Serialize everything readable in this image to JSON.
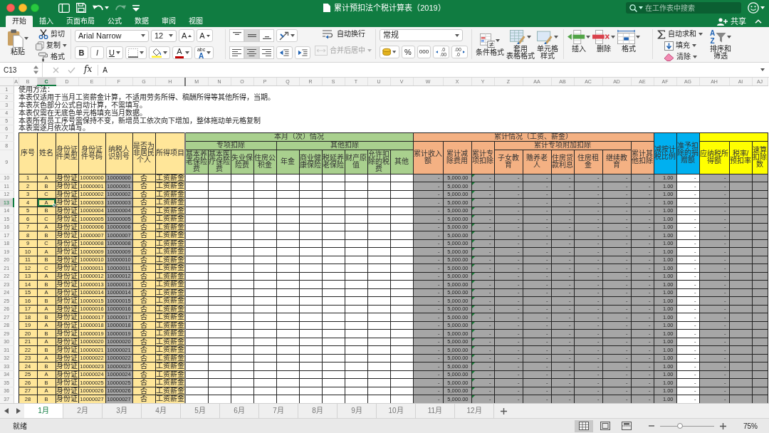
{
  "window": {
    "title": "累计预扣法个税计算表（2019）",
    "search": {
      "placeholder": "在工作表中搜索"
    }
  },
  "quick_access": [
    {
      "disabled": false
    },
    {
      "disabled": false
    },
    {
      "disabled": false
    },
    {
      "disabled": true
    },
    {
      "disabled": false
    }
  ],
  "ribbon_tabs": [
    {
      "label": "开始",
      "selected": true
    },
    {
      "label": "插入",
      "selected": false
    },
    {
      "label": "页面布局",
      "selected": false
    },
    {
      "label": "公式",
      "selected": false
    },
    {
      "label": "数据",
      "selected": false
    },
    {
      "label": "审阅",
      "selected": false
    },
    {
      "label": "视图",
      "selected": false
    }
  ],
  "share": {
    "label": "共享"
  },
  "ribbon": {
    "paste": {
      "label": "粘贴"
    },
    "clipboard": [
      {
        "label": "剪切"
      },
      {
        "label": "复制"
      },
      {
        "label": "格式"
      }
    ],
    "font_name": "Arial Narrow",
    "font_size": "12",
    "grow_font": "A",
    "shrink_font": "A",
    "text_styles": [
      {
        "label": "B"
      },
      {
        "label": "I"
      },
      {
        "label": "U"
      }
    ],
    "font_color": "A",
    "phonetic": [
      "abc",
      "A"
    ],
    "vertical_align": [
      {
        "selected": false
      },
      {
        "selected": true
      },
      {
        "selected": false
      }
    ],
    "horizontal_align": [
      {
        "selected": false
      },
      {
        "selected": true
      },
      {
        "selected": false
      }
    ],
    "wrap_text": {
      "label": "自动换行"
    },
    "merge_center": {
      "label": "合并后居中",
      "disabled": true
    },
    "number_format": "常规",
    "percent": "%",
    "thousands": "000",
    "increase_decimal": [
      ".0",
      ".00"
    ],
    "decrease_decimal": [
      ".00",
      ".0"
    ],
    "styles": [
      {
        "lines": [
          "条件格式"
        ]
      },
      {
        "lines": [
          "套用",
          "表格格式"
        ]
      },
      {
        "lines": [
          "单元格",
          "样式"
        ]
      }
    ],
    "cells": [
      {
        "lines": [
          "插入"
        ]
      },
      {
        "lines": [
          "删除"
        ]
      },
      {
        "lines": [
          "格式"
        ]
      }
    ],
    "editing": [
      {
        "label": "自动求和"
      },
      {
        "label": "填充"
      },
      {
        "label": "清除"
      }
    ],
    "sort_filter": {
      "glyphs": [
        "A",
        "Z"
      ],
      "lines": [
        "排序和",
        "筛选"
      ]
    }
  },
  "formula_bar": {
    "name_box": "C13",
    "fx": "fx",
    "value": "A"
  },
  "sheet": {
    "columns": [
      {
        "letter": "A",
        "kind": "margin",
        "selected": false,
        "flagged": false,
        "split": false
      },
      {
        "letter": "B",
        "kind": "info",
        "selected": false,
        "flagged": false,
        "split": false
      },
      {
        "letter": "C",
        "kind": "info",
        "selected": true,
        "flagged": false,
        "split": false
      },
      {
        "letter": "D",
        "kind": "info",
        "selected": false,
        "flagged": false,
        "split": false
      },
      {
        "letter": "E",
        "kind": "info",
        "selected": false,
        "flagged": false,
        "split": false
      },
      {
        "letter": "F",
        "kind": "formula",
        "selected": false,
        "flagged": false,
        "split": false
      },
      {
        "letter": "G",
        "kind": "info",
        "selected": false,
        "flagged": false,
        "split": false
      },
      {
        "letter": "H",
        "kind": "info",
        "selected": false,
        "flagged": false,
        "split": false
      },
      {
        "letter": "M",
        "kind": "entry",
        "selected": false,
        "flagged": false,
        "split": true
      },
      {
        "letter": "N",
        "kind": "entry",
        "selected": false,
        "flagged": false,
        "split": false
      },
      {
        "letter": "O",
        "kind": "entry",
        "selected": false,
        "flagged": false,
        "split": false
      },
      {
        "letter": "P",
        "kind": "entry",
        "selected": false,
        "flagged": false,
        "split": false
      },
      {
        "letter": "Q",
        "kind": "entry",
        "selected": false,
        "flagged": false,
        "split": false
      },
      {
        "letter": "R",
        "kind": "entry",
        "selected": false,
        "flagged": false,
        "split": false
      },
      {
        "letter": "S",
        "kind": "entry",
        "selected": false,
        "flagged": false,
        "split": false
      },
      {
        "letter": "T",
        "kind": "entry",
        "selected": false,
        "flagged": false,
        "split": false
      },
      {
        "letter": "U",
        "kind": "entry",
        "selected": false,
        "flagged": false,
        "split": false
      },
      {
        "letter": "V",
        "kind": "entry",
        "selected": false,
        "flagged": false,
        "split": false
      },
      {
        "letter": "W",
        "kind": "formula",
        "selected": false,
        "flagged": false,
        "split": false
      },
      {
        "letter": "X",
        "kind": "formula",
        "selected": false,
        "flagged": false,
        "split": false
      },
      {
        "letter": "Y",
        "kind": "formula",
        "selected": false,
        "flagged": true,
        "split": false
      },
      {
        "letter": "Z",
        "kind": "formula",
        "selected": false,
        "flagged": false,
        "split": false
      },
      {
        "letter": "AA",
        "kind": "formula",
        "selected": false,
        "flagged": false,
        "split": false
      },
      {
        "letter": "AB",
        "kind": "formula",
        "selected": false,
        "flagged": false,
        "split": false
      },
      {
        "letter": "AC",
        "kind": "formula",
        "selected": false,
        "flagged": false,
        "split": false
      },
      {
        "letter": "AD",
        "kind": "formula",
        "selected": false,
        "flagged": false,
        "split": false
      },
      {
        "letter": "AE",
        "kind": "formula",
        "selected": false,
        "flagged": false,
        "split": false
      },
      {
        "letter": "AF",
        "kind": "formula",
        "selected": false,
        "flagged": false,
        "split": false
      },
      {
        "letter": "AG",
        "kind": "entry",
        "selected": false,
        "flagged": false,
        "split": false
      },
      {
        "letter": "AH",
        "kind": "formula",
        "selected": false,
        "flagged": false,
        "split": false
      },
      {
        "letter": "AI",
        "kind": "formula",
        "selected": false,
        "flagged": false,
        "split": false
      },
      {
        "letter": "AJ",
        "kind": "formula",
        "selected": false,
        "flagged": false,
        "split": false
      }
    ],
    "notes": [
      {
        "number": "1",
        "selected": false,
        "text": "使用方法："
      },
      {
        "number": "2",
        "selected": false,
        "text": "本表仅适用于当月工资薪金计算，不适用劳务所得、稿酬所得等其他所得，当期。"
      },
      {
        "number": "3",
        "selected": false,
        "text": "本表灰色部分公式自动计算，不需填写。"
      },
      {
        "number": "4",
        "selected": false,
        "text": "本表仅需在无底色单元格填充当月数据。"
      },
      {
        "number": "5",
        "selected": false,
        "text": "本表所有员工序号需保持不变，新增员工依次向下增加，整体拖动单元格复制"
      },
      {
        "number": "6",
        "selected": false,
        "text": "本表需逐月依次填写。"
      }
    ],
    "header_rows": [
      {
        "number": "7",
        "selected": false
      },
      {
        "number": "8",
        "selected": false
      },
      {
        "number": "9",
        "selected": false
      }
    ],
    "header": [
      {
        "label": "序号",
        "color": "#ffe699"
      },
      {
        "label": "姓名",
        "color": "#ffe699"
      },
      {
        "label": "身份证件类型",
        "color": "#ffe699"
      },
      {
        "label": "身份证件号码",
        "color": "#ffe699"
      },
      {
        "label": "纳税人识别号",
        "color": "#ffe699"
      },
      {
        "label": "是否为非居民个人",
        "color": "#ffe699"
      },
      {
        "label": "所得项目",
        "color": "#ffe699"
      },
      {
        "label": "本月（次）情况",
        "color": "#a9d08e",
        "children": [
          {
            "label": "专项扣除",
            "children": [
              {
                "label": "基本养老保险费"
              },
              {
                "label": "基本医疗保险费"
              },
              {
                "label": "失业保险费"
              },
              {
                "label": "住房公积金"
              }
            ]
          },
          {
            "label": "其他扣除",
            "children": [
              {
                "label": "年金"
              },
              {
                "label": "商业健康保险"
              },
              {
                "label": "税延养老保险"
              },
              {
                "label": "财产原值"
              },
              {
                "label": "允许扣除的税费"
              },
              {
                "label": "其他"
              }
            ]
          }
        ]
      },
      {
        "label": "累计情况（工资、薪金）",
        "color": "#f4b183",
        "children": [
          {
            "label": "累计收入额"
          },
          {
            "label": "累计减除费用"
          },
          {
            "label": "累计专项扣除"
          },
          {
            "label": "累计专项附加扣除",
            "children": [
              {
                "label": "子女教育"
              },
              {
                "label": "赡养老人"
              },
              {
                "label": "住房贷款利息"
              },
              {
                "label": "住房租金"
              },
              {
                "label": "继续教育"
              }
            ]
          },
          {
            "label": "累计其他扣除"
          }
        ]
      },
      {
        "label": "减按计税比例",
        "color": "#00b0f0"
      },
      {
        "label": "准予扣除的捐赠额",
        "color": "#00b0f0"
      },
      {
        "color": "#ffff00",
        "children": [
          {
            "label": "应纳税所得额"
          },
          {
            "label": "税率/预扣率"
          },
          {
            "label": "速算扣除数"
          }
        ]
      }
    ],
    "rows": [
      {
        "number": "10",
        "selected": false,
        "cells": [
          "",
          "1",
          "A",
          "身份证",
          "10000000",
          "10000000",
          "否",
          "工资薪金",
          "",
          "",
          "",
          "",
          "",
          "",
          "",
          "",
          "",
          "",
          "-",
          "5,000.00",
          "-",
          "-",
          "-",
          "-",
          "-",
          "-",
          "-",
          "1.00",
          "-",
          "-",
          "",
          ""
        ]
      },
      {
        "number": "11",
        "selected": false,
        "cells": [
          "",
          "2",
          "B",
          "身份证",
          "10000001",
          "10000001",
          "否",
          "工资薪金",
          "",
          "",
          "",
          "",
          "",
          "",
          "",
          "",
          "",
          "",
          "-",
          "5,000.00",
          "-",
          "-",
          "-",
          "-",
          "-",
          "-",
          "-",
          "1.00",
          "-",
          "-",
          "",
          ""
        ]
      },
      {
        "number": "12",
        "selected": false,
        "cells": [
          "",
          "3",
          "C",
          "身份证",
          "10000002",
          "10000002",
          "否",
          "工资薪金",
          "",
          "",
          "",
          "",
          "",
          "",
          "",
          "",
          "",
          "",
          "-",
          "5,000.00",
          "-",
          "-",
          "-",
          "-",
          "-",
          "-",
          "-",
          "1.00",
          "-",
          "-",
          "",
          ""
        ]
      },
      {
        "number": "13",
        "selected": true,
        "cells": [
          "",
          "4",
          "A",
          "身份证",
          "10000003",
          "10000003",
          "否",
          "工资薪金",
          "",
          "",
          "",
          "",
          "",
          "",
          "",
          "",
          "",
          "",
          "-",
          "5,000.00",
          "-",
          "-",
          "-",
          "-",
          "-",
          "-",
          "-",
          "1.00",
          "-",
          "-",
          "",
          ""
        ]
      },
      {
        "number": "14",
        "selected": false,
        "cells": [
          "",
          "5",
          "B",
          "身份证",
          "10000004",
          "10000004",
          "否",
          "工资薪金",
          "",
          "",
          "",
          "",
          "",
          "",
          "",
          "",
          "",
          "",
          "-",
          "5,000.00",
          "-",
          "-",
          "-",
          "-",
          "-",
          "-",
          "-",
          "1.00",
          "-",
          "-",
          "",
          ""
        ]
      },
      {
        "number": "15",
        "selected": false,
        "cells": [
          "",
          "6",
          "C",
          "身份证",
          "10000005",
          "10000005",
          "否",
          "工资薪金",
          "",
          "",
          "",
          "",
          "",
          "",
          "",
          "",
          "",
          "",
          "-",
          "5,000.00",
          "-",
          "-",
          "-",
          "-",
          "-",
          "-",
          "-",
          "1.00",
          "-",
          "-",
          "",
          ""
        ]
      },
      {
        "number": "16",
        "selected": false,
        "cells": [
          "",
          "7",
          "A",
          "身份证",
          "10000006",
          "10000006",
          "否",
          "工资薪金",
          "",
          "",
          "",
          "",
          "",
          "",
          "",
          "",
          "",
          "",
          "-",
          "5,000.00",
          "-",
          "-",
          "-",
          "-",
          "-",
          "-",
          "-",
          "1.00",
          "-",
          "-",
          "",
          ""
        ]
      },
      {
        "number": "17",
        "selected": false,
        "cells": [
          "",
          "8",
          "B",
          "身份证",
          "10000007",
          "10000007",
          "否",
          "工资薪金",
          "",
          "",
          "",
          "",
          "",
          "",
          "",
          "",
          "",
          "",
          "-",
          "5,000.00",
          "-",
          "-",
          "-",
          "-",
          "-",
          "-",
          "-",
          "1.00",
          "-",
          "-",
          "",
          ""
        ]
      },
      {
        "number": "18",
        "selected": false,
        "cells": [
          "",
          "9",
          "C",
          "身份证",
          "10000008",
          "10000008",
          "否",
          "工资薪金",
          "",
          "",
          "",
          "",
          "",
          "",
          "",
          "",
          "",
          "",
          "-",
          "5,000.00",
          "-",
          "-",
          "-",
          "-",
          "-",
          "-",
          "-",
          "1.00",
          "-",
          "-",
          "",
          ""
        ]
      },
      {
        "number": "19",
        "selected": false,
        "cells": [
          "",
          "10",
          "A",
          "身份证",
          "10000009",
          "10000009",
          "否",
          "工资薪金",
          "",
          "",
          "",
          "",
          "",
          "",
          "",
          "",
          "",
          "",
          "-",
          "5,000.00",
          "-",
          "-",
          "-",
          "-",
          "-",
          "-",
          "-",
          "1.00",
          "-",
          "-",
          "",
          ""
        ]
      },
      {
        "number": "20",
        "selected": false,
        "cells": [
          "",
          "11",
          "B",
          "身份证",
          "10000010",
          "10000010",
          "否",
          "工资薪金",
          "",
          "",
          "",
          "",
          "",
          "",
          "",
          "",
          "",
          "",
          "-",
          "5,000.00",
          "-",
          "-",
          "-",
          "-",
          "-",
          "-",
          "-",
          "1.00",
          "-",
          "-",
          "",
          ""
        ]
      },
      {
        "number": "21",
        "selected": false,
        "cells": [
          "",
          "12",
          "C",
          "身份证",
          "10000011",
          "10000011",
          "否",
          "工资薪金",
          "",
          "",
          "",
          "",
          "",
          "",
          "",
          "",
          "",
          "",
          "-",
          "5,000.00",
          "-",
          "-",
          "-",
          "-",
          "-",
          "-",
          "-",
          "1.00",
          "-",
          "-",
          "",
          ""
        ]
      },
      {
        "number": "22",
        "selected": false,
        "cells": [
          "",
          "13",
          "A",
          "身份证",
          "10000012",
          "10000012",
          "否",
          "工资薪金",
          "",
          "",
          "",
          "",
          "",
          "",
          "",
          "",
          "",
          "",
          "-",
          "5,000.00",
          "-",
          "-",
          "-",
          "-",
          "-",
          "-",
          "-",
          "1.00",
          "-",
          "-",
          "",
          ""
        ]
      },
      {
        "number": "23",
        "selected": false,
        "cells": [
          "",
          "14",
          "B",
          "身份证",
          "10000013",
          "10000013",
          "否",
          "工资薪金",
          "",
          "",
          "",
          "",
          "",
          "",
          "",
          "",
          "",
          "",
          "-",
          "5,000.00",
          "-",
          "-",
          "-",
          "-",
          "-",
          "-",
          "-",
          "1.00",
          "-",
          "-",
          "",
          ""
        ]
      },
      {
        "number": "24",
        "selected": false,
        "cells": [
          "",
          "15",
          "A",
          "身份证",
          "10000014",
          "10000014",
          "否",
          "工资薪金",
          "",
          "",
          "",
          "",
          "",
          "",
          "",
          "",
          "",
          "",
          "-",
          "5,000.00",
          "-",
          "-",
          "-",
          "-",
          "-",
          "-",
          "-",
          "1.00",
          "-",
          "-",
          "",
          ""
        ]
      },
      {
        "number": "25",
        "selected": false,
        "cells": [
          "",
          "16",
          "B",
          "身份证",
          "10000015",
          "10000015",
          "否",
          "工资薪金",
          "",
          "",
          "",
          "",
          "",
          "",
          "",
          "",
          "",
          "",
          "-",
          "5,000.00",
          "-",
          "-",
          "-",
          "-",
          "-",
          "-",
          "-",
          "1.00",
          "-",
          "-",
          "",
          ""
        ]
      },
      {
        "number": "26",
        "selected": false,
        "cells": [
          "",
          "17",
          "A",
          "身份证",
          "10000016",
          "10000016",
          "否",
          "工资薪金",
          "",
          "",
          "",
          "",
          "",
          "",
          "",
          "",
          "",
          "",
          "-",
          "5,000.00",
          "-",
          "-",
          "-",
          "-",
          "-",
          "-",
          "-",
          "1.00",
          "-",
          "-",
          "",
          ""
        ]
      },
      {
        "number": "27",
        "selected": false,
        "cells": [
          "",
          "18",
          "B",
          "身份证",
          "10000017",
          "10000017",
          "否",
          "工资薪金",
          "",
          "",
          "",
          "",
          "",
          "",
          "",
          "",
          "",
          "",
          "-",
          "5,000.00",
          "-",
          "-",
          "-",
          "-",
          "-",
          "-",
          "-",
          "1.00",
          "-",
          "-",
          "",
          ""
        ]
      },
      {
        "number": "28",
        "selected": false,
        "cells": [
          "",
          "19",
          "A",
          "身份证",
          "10000018",
          "10000018",
          "否",
          "工资薪金",
          "",
          "",
          "",
          "",
          "",
          "",
          "",
          "",
          "",
          "",
          "-",
          "5,000.00",
          "-",
          "-",
          "-",
          "-",
          "-",
          "-",
          "-",
          "1.00",
          "-",
          "-",
          "",
          ""
        ]
      },
      {
        "number": "29",
        "selected": false,
        "cells": [
          "",
          "20",
          "B",
          "身份证",
          "10000019",
          "10000019",
          "否",
          "工资薪金",
          "",
          "",
          "",
          "",
          "",
          "",
          "",
          "",
          "",
          "",
          "-",
          "5,000.00",
          "-",
          "-",
          "-",
          "-",
          "-",
          "-",
          "-",
          "1.00",
          "-",
          "-",
          "",
          ""
        ]
      },
      {
        "number": "30",
        "selected": false,
        "cells": [
          "",
          "21",
          "A",
          "身份证",
          "10000020",
          "10000020",
          "否",
          "工资薪金",
          "",
          "",
          "",
          "",
          "",
          "",
          "",
          "",
          "",
          "",
          "-",
          "5,000.00",
          "-",
          "-",
          "-",
          "-",
          "-",
          "-",
          "-",
          "1.00",
          "-",
          "-",
          "",
          ""
        ]
      },
      {
        "number": "31",
        "selected": false,
        "cells": [
          "",
          "22",
          "B",
          "身份证",
          "10000021",
          "10000021",
          "否",
          "工资薪金",
          "",
          "",
          "",
          "",
          "",
          "",
          "",
          "",
          "",
          "",
          "-",
          "5,000.00",
          "-",
          "-",
          "-",
          "-",
          "-",
          "-",
          "-",
          "1.00",
          "-",
          "-",
          "",
          ""
        ]
      },
      {
        "number": "32",
        "selected": false,
        "cells": [
          "",
          "23",
          "A",
          "身份证",
          "10000022",
          "10000022",
          "否",
          "工资薪金",
          "",
          "",
          "",
          "",
          "",
          "",
          "",
          "",
          "",
          "",
          "-",
          "5,000.00",
          "-",
          "-",
          "-",
          "-",
          "-",
          "-",
          "-",
          "1.00",
          "-",
          "-",
          "",
          ""
        ]
      },
      {
        "number": "33",
        "selected": false,
        "cells": [
          "",
          "24",
          "B",
          "身份证",
          "10000023",
          "10000023",
          "否",
          "工资薪金",
          "",
          "",
          "",
          "",
          "",
          "",
          "",
          "",
          "",
          "",
          "-",
          "5,000.00",
          "-",
          "-",
          "-",
          "-",
          "-",
          "-",
          "-",
          "1.00",
          "-",
          "-",
          "",
          ""
        ]
      },
      {
        "number": "34",
        "selected": false,
        "cells": [
          "",
          "25",
          "A",
          "身份证",
          "10000024",
          "10000024",
          "否",
          "工资薪金",
          "",
          "",
          "",
          "",
          "",
          "",
          "",
          "",
          "",
          "",
          "-",
          "5,000.00",
          "-",
          "-",
          "-",
          "-",
          "-",
          "-",
          "-",
          "1.00",
          "-",
          "-",
          "",
          ""
        ]
      },
      {
        "number": "35",
        "selected": false,
        "cells": [
          "",
          "26",
          "B",
          "身份证",
          "10000025",
          "10000025",
          "否",
          "工资薪金",
          "",
          "",
          "",
          "",
          "",
          "",
          "",
          "",
          "",
          "",
          "-",
          "5,000.00",
          "-",
          "-",
          "-",
          "-",
          "-",
          "-",
          "-",
          "1.00",
          "-",
          "-",
          "",
          ""
        ]
      },
      {
        "number": "36",
        "selected": false,
        "cells": [
          "",
          "27",
          "A",
          "身份证",
          "10000026",
          "10000026",
          "否",
          "工资薪金",
          "",
          "",
          "",
          "",
          "",
          "",
          "",
          "",
          "",
          "",
          "-",
          "5,000.00",
          "-",
          "-",
          "-",
          "-",
          "-",
          "-",
          "-",
          "1.00",
          "-",
          "-",
          "",
          ""
        ]
      },
      {
        "number": "37",
        "selected": false,
        "cells": [
          "",
          "28",
          "B",
          "身份证",
          "10000027",
          "10000027",
          "否",
          "工资薪金",
          "",
          "",
          "",
          "",
          "",
          "",
          "",
          "",
          "",
          "",
          "-",
          "5,000.00",
          "-",
          "-",
          "-",
          "-",
          "-",
          "-",
          "-",
          "1.00",
          "-",
          "-",
          "",
          ""
        ]
      }
    ]
  },
  "sheet_tabs": [
    {
      "label": "1月",
      "selected": true
    },
    {
      "label": "2月",
      "selected": false
    },
    {
      "label": "3月",
      "selected": false
    },
    {
      "label": "4月",
      "selected": false
    },
    {
      "label": "5月",
      "selected": false
    },
    {
      "label": "6月",
      "selected": false
    },
    {
      "label": "7月",
      "selected": false
    },
    {
      "label": "8月",
      "selected": false
    },
    {
      "label": "9月",
      "selected": false
    },
    {
      "label": "10月",
      "selected": false
    },
    {
      "label": "11月",
      "selected": false
    },
    {
      "label": "12月",
      "selected": false
    }
  ],
  "status": {
    "text": "就绪",
    "views": [
      {
        "selected": true
      },
      {
        "selected": false
      },
      {
        "selected": false
      }
    ],
    "zoom": {
      "level": 0.36,
      "label": "75%"
    }
  }
}
